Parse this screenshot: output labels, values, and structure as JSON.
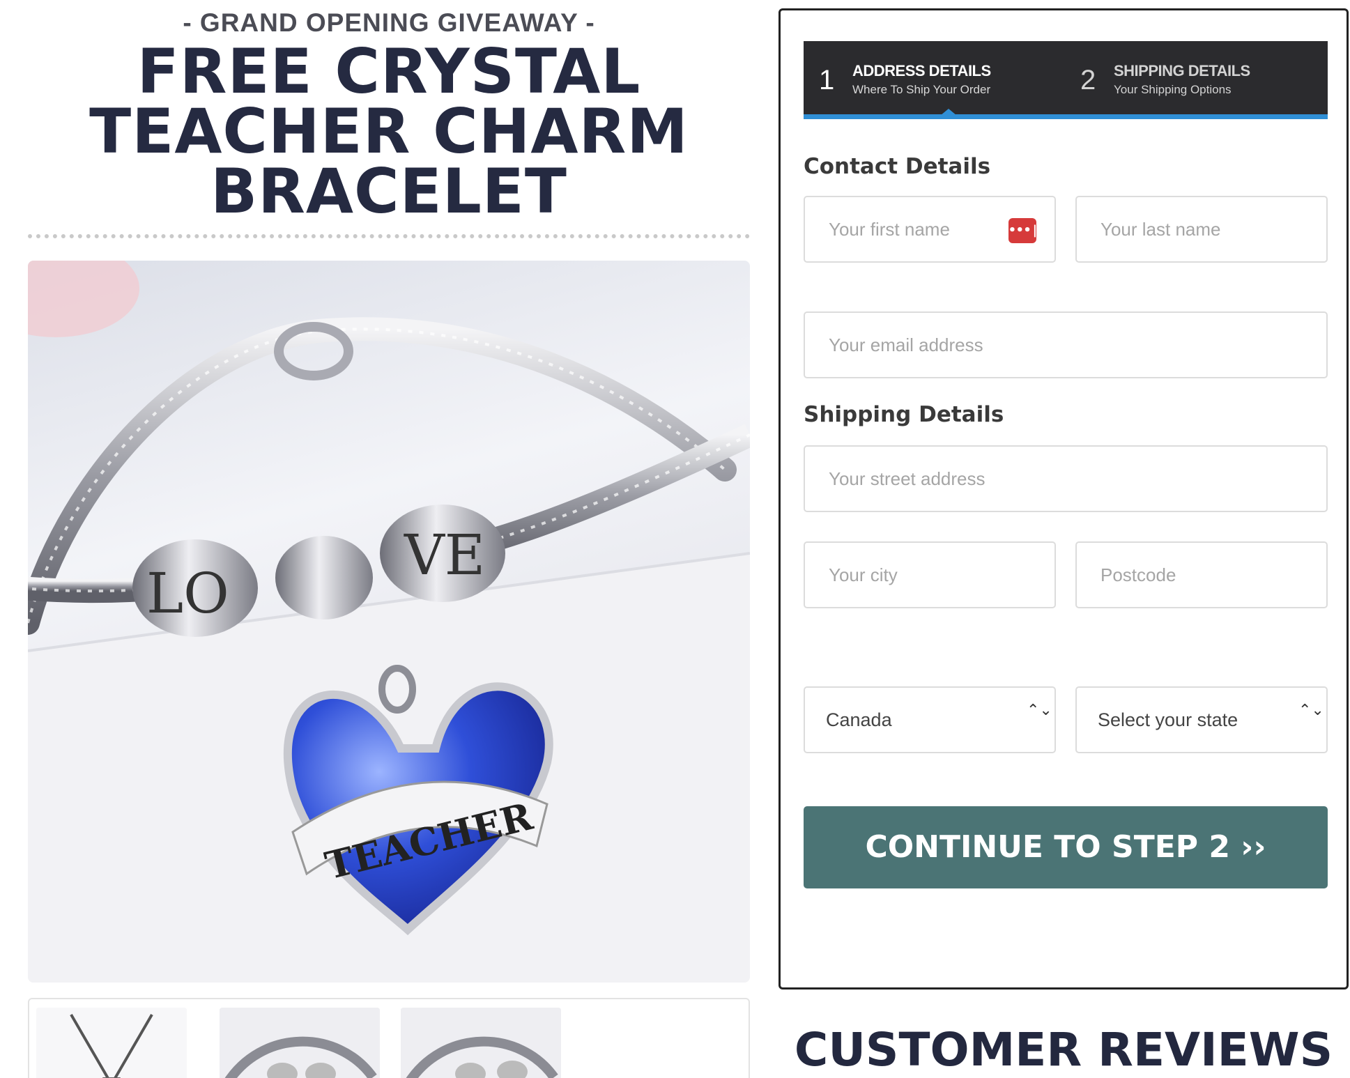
{
  "hero": {
    "kicker": "- GRAND OPENING GIVEAWAY -",
    "title_line1": "FREE CRYSTAL",
    "title_line2": "TEACHER CHARM",
    "title_line3": "BRACELET"
  },
  "product": {
    "charm_text": "TEACHER",
    "bead_text_left": "LO",
    "bead_text_right": "VE",
    "thumbnail_count": 3
  },
  "steps": [
    {
      "number": "1",
      "title": "ADDRESS DETAILS",
      "subtitle": "Where To Ship Your Order"
    },
    {
      "number": "2",
      "title": "SHIPPING DETAILS",
      "subtitle": "Your Shipping Options"
    }
  ],
  "form": {
    "contact_heading": "Contact Details",
    "shipping_heading": "Shipping Details",
    "first_name_placeholder": "Your first name",
    "last_name_placeholder": "Your last name",
    "email_placeholder": "Your email address",
    "street_placeholder": "Your street address",
    "city_placeholder": "Your city",
    "postcode_placeholder": "Postcode",
    "country_value": "Canada",
    "state_value": "Select your state",
    "password_badge": "•••|",
    "select_arrows": "⌃⌄",
    "submit_label": "CONTINUE TO STEP 2 ››"
  },
  "reviews": {
    "heading": "CUSTOMER REVIEWS"
  },
  "colors": {
    "accent_blue": "#2f8fd6",
    "cta_teal": "#4b7475",
    "header_dark": "#2b2b2e",
    "title_navy": "#252a41",
    "badge_red": "#d63a3a"
  }
}
